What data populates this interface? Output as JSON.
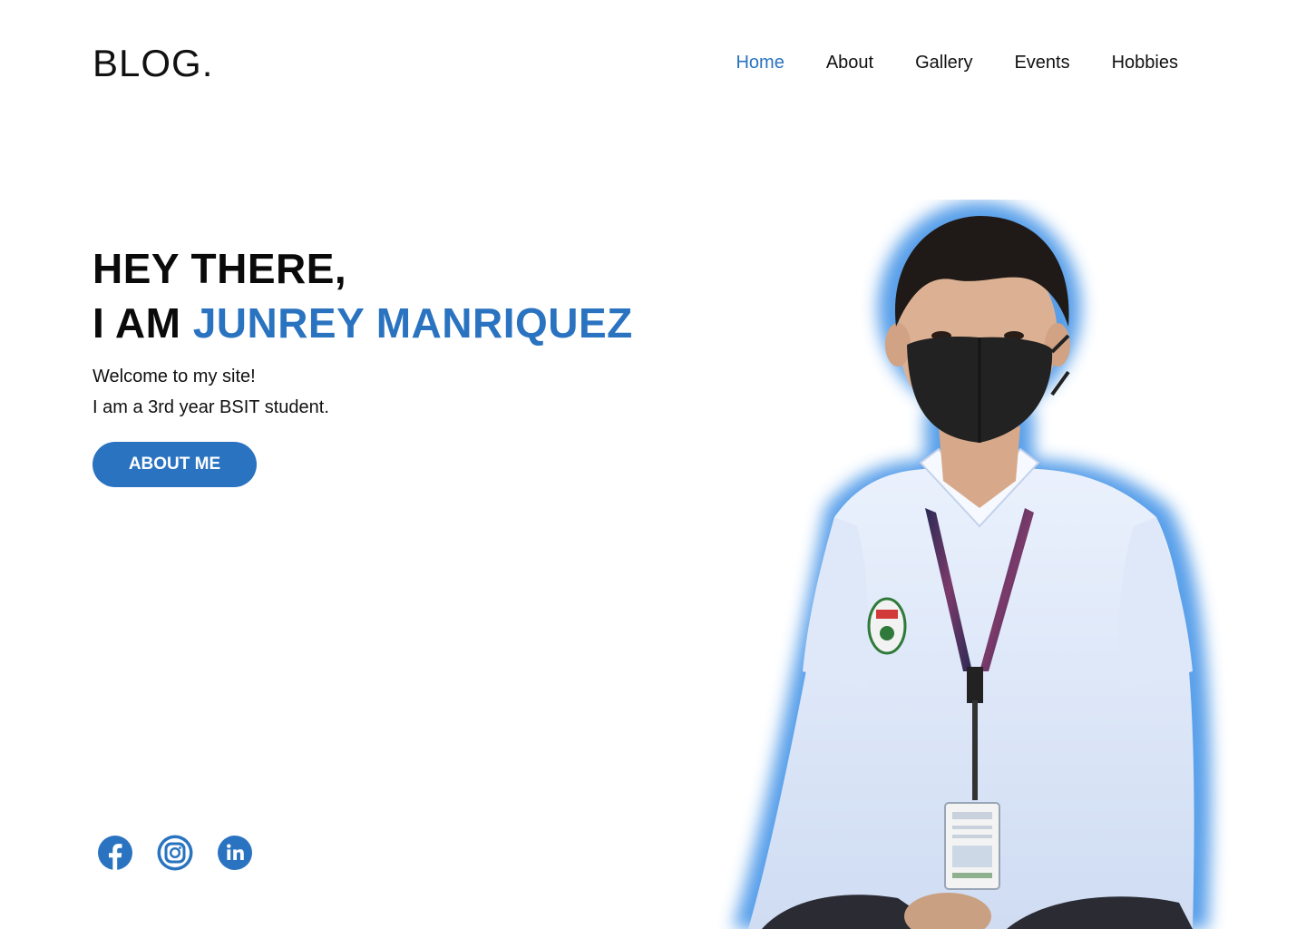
{
  "brand": {
    "logo": "BLOG."
  },
  "nav": {
    "items": [
      {
        "label": "Home",
        "active": true
      },
      {
        "label": "About",
        "active": false
      },
      {
        "label": "Gallery",
        "active": false
      },
      {
        "label": "Events",
        "active": false
      },
      {
        "label": "Hobbies",
        "active": false
      }
    ]
  },
  "hero": {
    "greeting": "HEY THERE,",
    "prefix": "I AM",
    "name": "JUNREY MANRIQUEZ",
    "welcome": "Welcome to my site!",
    "description": "I am a 3rd year BSIT student.",
    "cta_label": "ABOUT ME"
  },
  "social": [
    {
      "icon": "facebook-icon"
    },
    {
      "icon": "instagram-icon"
    },
    {
      "icon": "linkedin-icon"
    }
  ],
  "portrait": {
    "icon": "profile-photo"
  },
  "colors": {
    "accent": "#2a73c0",
    "text": "#111111",
    "background": "#ffffff"
  }
}
